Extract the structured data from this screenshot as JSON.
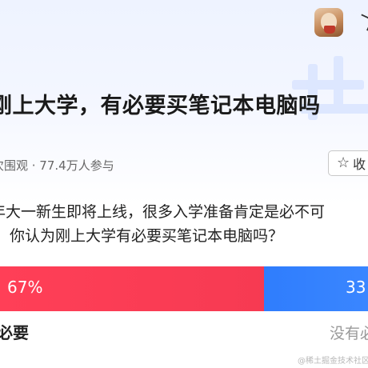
{
  "question": {
    "title": "刚上大学，有必要买笔记本电脑吗",
    "stats_text": "次围观 · 77.4万人参与",
    "fav_label": "收",
    "description_line1": "年大一新生即将上线，很多入学准备肯定是必不可",
    "description_line2": "你认为刚上大学有必要买笔记本电脑吗？"
  },
  "vote": {
    "left_percent_label": "67%",
    "right_percent_label": "33",
    "left_fraction": 0.67,
    "left_option": "必要",
    "right_option": "没有必",
    "left_color": "#ff3f57",
    "right_color": "#2f7dfd"
  },
  "icons": {
    "fav": "star-outline-icon",
    "avatar": "user-avatar"
  },
  "watermark": "@稀土掘金技术社区"
}
